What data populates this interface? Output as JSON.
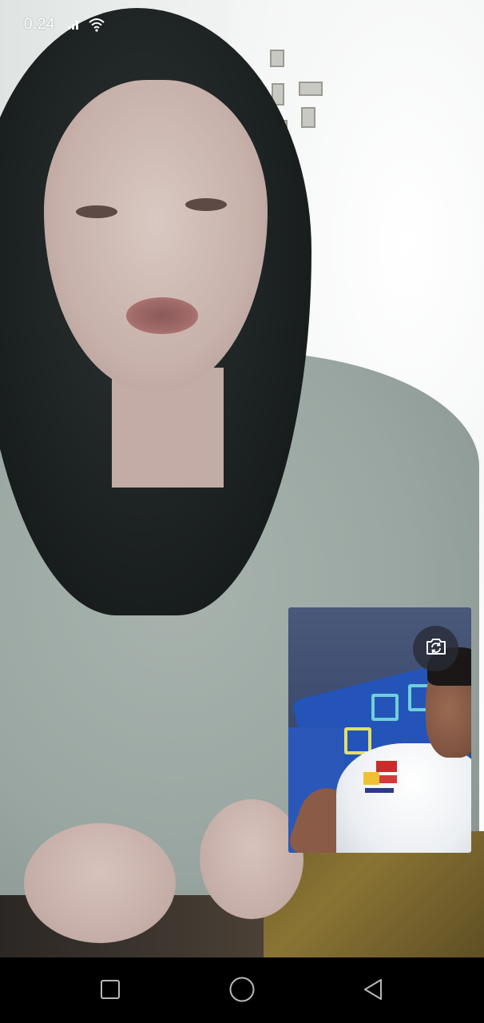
{
  "status_bar": {
    "time": "0.24",
    "icons": [
      "signal-icon",
      "wifi-icon"
    ]
  },
  "call": {
    "remote_video": "remote-video-feed",
    "self_view": "local-camera-preview",
    "switch_camera_icon": "switch-camera-icon"
  },
  "nav_bar": {
    "buttons": [
      "recents-square-icon",
      "home-circle-icon",
      "back-triangle-icon"
    ]
  },
  "colors": {
    "nav_background": "#000000",
    "icon_color": "#ffffff",
    "nav_icon_color": "#b8b8b8",
    "switch_button_bg": "#282c34"
  }
}
